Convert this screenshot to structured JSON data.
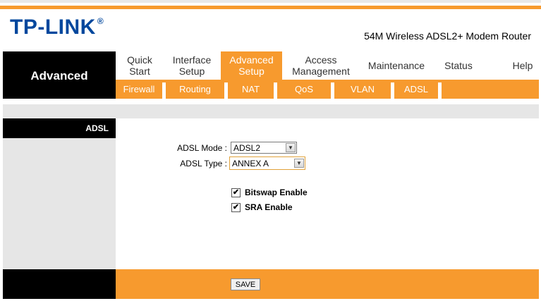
{
  "brand": {
    "logo": "TP-LINK",
    "reg": "®",
    "model": "54M Wireless ADSL2+ Modem Router"
  },
  "nav": {
    "section": "Advanced",
    "items": [
      {
        "l1": "Quick",
        "l2": "Start"
      },
      {
        "l1": "Interface",
        "l2": "Setup"
      },
      {
        "l1": "Advanced",
        "l2": "Setup"
      },
      {
        "l1": "Access",
        "l2": "Management"
      },
      {
        "l1": "Maintenance",
        "l2": ""
      },
      {
        "l1": "Status",
        "l2": ""
      },
      {
        "l1": "Help",
        "l2": ""
      }
    ],
    "sub": [
      "Firewall",
      "Routing",
      "NAT",
      "QoS",
      "VLAN",
      "ADSL"
    ]
  },
  "side": {
    "title": "ADSL"
  },
  "form": {
    "mode_label": "ADSL Mode :",
    "mode_value": "ADSL2",
    "type_label": "ADSL Type :",
    "type_value": "ANNEX A",
    "bitswap_label": "Bitswap Enable",
    "sra_label": "SRA Enable",
    "check_mark": "✔",
    "arrow": "▼"
  },
  "footer": {
    "save": "SAVE"
  }
}
